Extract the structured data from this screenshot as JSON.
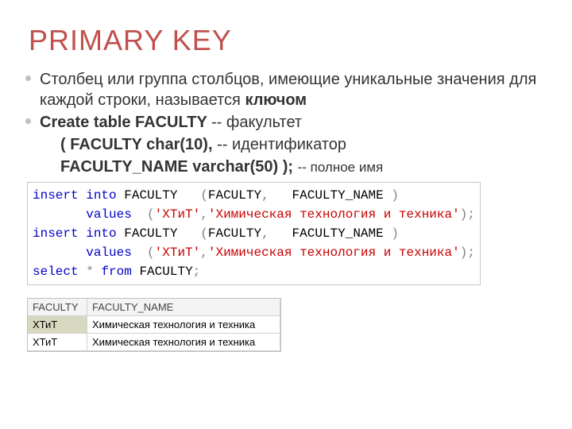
{
  "title": "PRIMARY KEY",
  "bullets": {
    "b1_pre": "Столбец или группа столбцов, имеющие уникальные значения для каждой строки, называется ",
    "b1_bold": "ключом",
    "b2_bold": "Create table FACULTY  ",
    "b2_tail": "-- факультет",
    "b3_bold": "(  FACULTY  char(10),  ",
    "b3_tail": "-- идентификатор",
    "b4_bold": "FACULTY_NAME varchar(50) ); ",
    "b4_tail": "-- полное имя"
  },
  "code": {
    "l1": {
      "kw1": "insert",
      "kw2": "into",
      "id1": "FACULTY",
      "p1": "(",
      "id2": "FACULTY",
      "c": ",",
      "id3": "FACULTY_NAME",
      "p2": ")"
    },
    "l2": {
      "kw": "values",
      "p1": "(",
      "s1": "'ХТиТ'",
      "c": ",",
      "s2": "'Химическая технология и техника'",
      "p2": ")",
      ";": ";"
    },
    "l3": {
      "kw1": "insert",
      "kw2": "into",
      "id1": "FACULTY",
      "p1": "(",
      "id2": "FACULTY",
      "c": ",",
      "id3": "FACULTY_NAME",
      "p2": ")"
    },
    "l4": {
      "kw": "values",
      "p1": "(",
      "s1": "'ХТиТ'",
      "c": ",",
      "s2": "'Химическая технология и техника'",
      "p2": ")",
      ";": ";"
    },
    "l5": {
      "kw1": "select",
      "star": "*",
      "kw2": "from",
      "id": "FACULTY",
      ";": ";"
    }
  },
  "table": {
    "headers": {
      "h1": "FACULTY",
      "h2": "FACULTY_NAME"
    },
    "rows": [
      {
        "c1": "ХТиТ",
        "c2": "Химическая технология и техника"
      },
      {
        "c1": "ХТиТ",
        "c2": "Химическая технология и техника"
      }
    ]
  }
}
